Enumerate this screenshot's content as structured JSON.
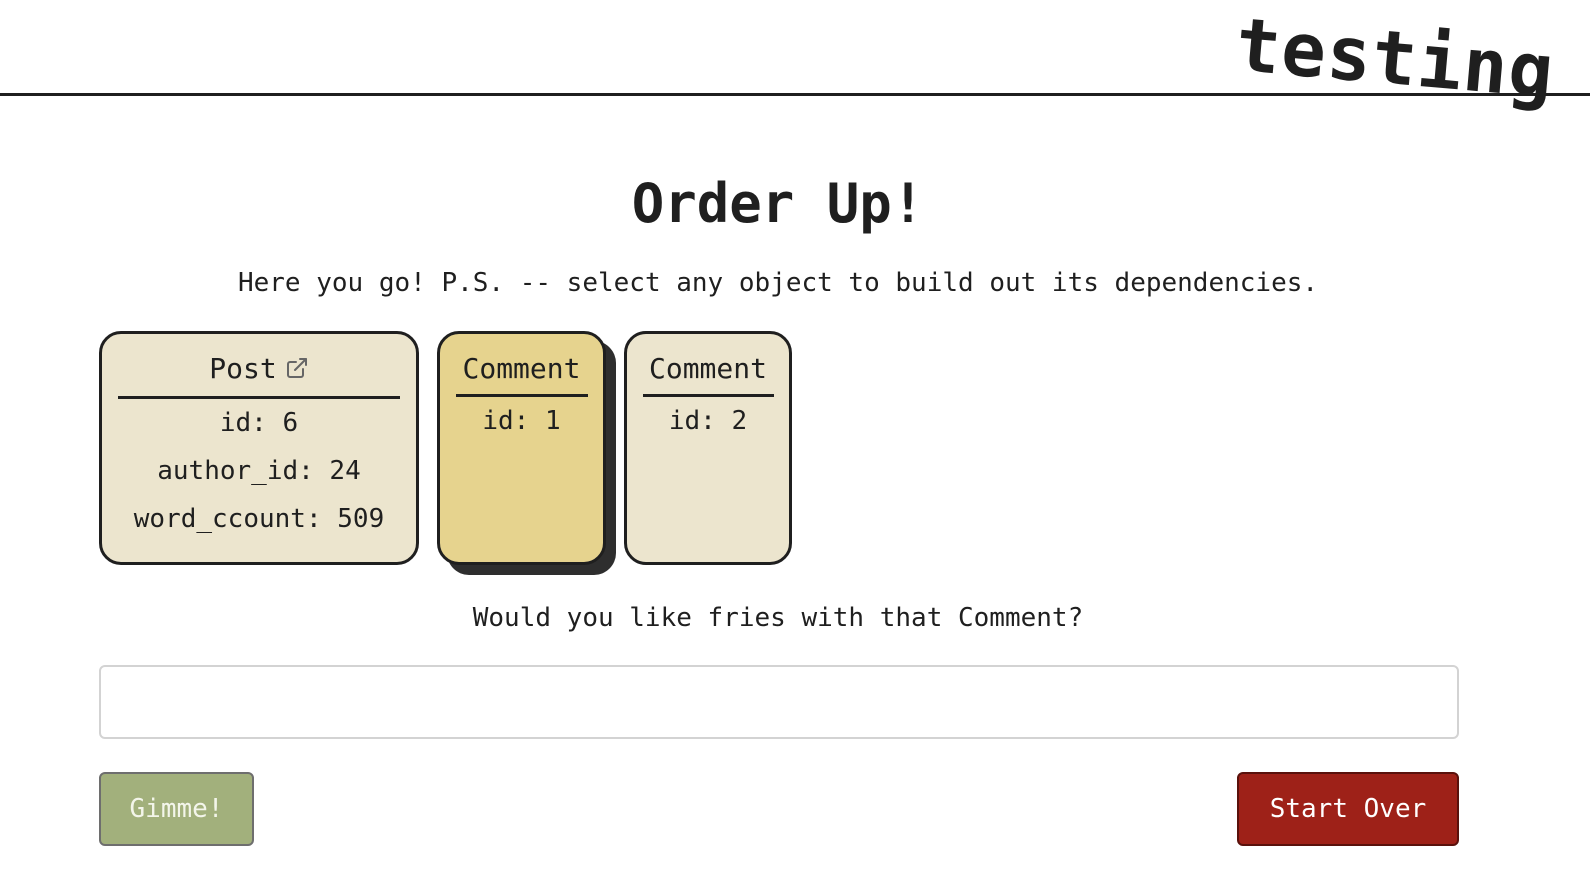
{
  "header": {
    "brand": "testing"
  },
  "main": {
    "title": "Order Up!",
    "subtitle": "Here you go! P.S. -- select any object to build out its dependencies."
  },
  "cards": [
    {
      "type": "Post",
      "has_link_icon": true,
      "selected": false,
      "fields": [
        "id: 6",
        "author_id: 24",
        "word_ccount: 509"
      ]
    },
    {
      "type": "Comment",
      "has_link_icon": false,
      "selected": true,
      "fields": [
        "id: 1"
      ]
    },
    {
      "type": "Comment",
      "has_link_icon": false,
      "selected": false,
      "fields": [
        "id: 2"
      ]
    }
  ],
  "prompt": {
    "question": "Would you like fries with that Comment?",
    "input_value": "",
    "input_placeholder": ""
  },
  "buttons": {
    "gimme": "Gimme!",
    "start_over": "Start Over"
  },
  "icons": {
    "external_link": "external-link-icon"
  },
  "colors": {
    "card_background": "#ece5ce",
    "card_selected_background": "#e6d38e",
    "gimme_button": "#a2b07c",
    "start_over_button": "#9e2118",
    "ink": "#1f1f1f"
  }
}
